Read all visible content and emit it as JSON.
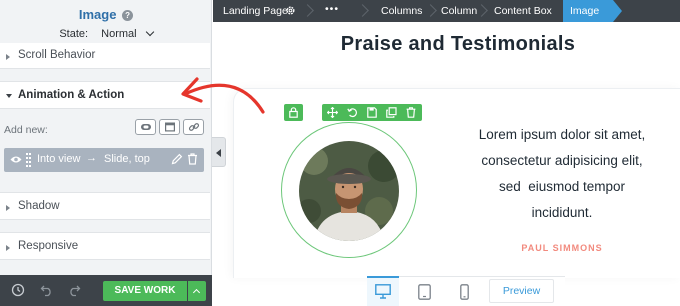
{
  "panel": {
    "title": "Image",
    "state_label": "State:",
    "state_value": "Normal",
    "sections": {
      "scroll": "Scroll Behavior",
      "animation": "Animation & Action",
      "shadow": "Shadow",
      "responsive": "Responsive"
    },
    "add_new_label": "Add new:",
    "animation_item": {
      "trigger": "Into view",
      "arrow": "→",
      "effect": "Slide, top"
    },
    "save_label": "SAVE WORK"
  },
  "breadcrumb": {
    "items": [
      "Landing Page",
      "Columns",
      "Column",
      "Content Box"
    ],
    "active": "Image",
    "more_icon": "•••"
  },
  "canvas": {
    "heading": "Praise and Testimonials",
    "quote_lines": [
      "Lorem ipsum dolor sit amet,",
      "consectetur adipisicing elit,",
      "sed  eiusmod tempor",
      "incididunt."
    ],
    "author": "PAUL SIMMONS"
  },
  "device_bar": {
    "preview_label": "Preview"
  },
  "colors": {
    "accent_green": "#4cba59",
    "accent_blue": "#3a9ad9",
    "annotation_red": "#e5362c",
    "author_coral": "#f28a7e"
  },
  "icons": [
    "help-icon",
    "chevron-down-icon",
    "eye-icon",
    "drag-handle-icon",
    "pencil-icon",
    "trash-icon",
    "history-icon",
    "undo-icon",
    "redo-icon",
    "gear-icon",
    "lock-icon",
    "move-icon",
    "reset-icon",
    "save-icon",
    "duplicate-icon",
    "desktop-icon",
    "tablet-icon",
    "mobile-icon"
  ]
}
